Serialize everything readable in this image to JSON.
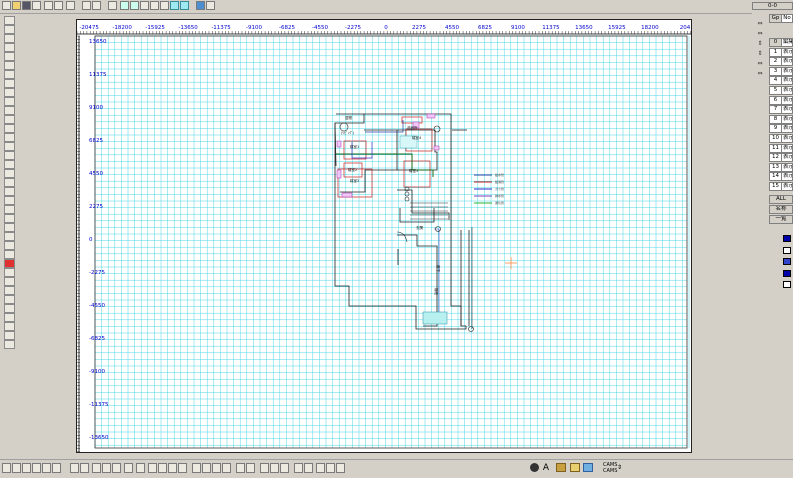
{
  "canvas": {
    "x_ruler_labels": [
      "-20475",
      "-18200",
      "-15925",
      "-13650",
      "-11375",
      "-9100",
      "-6825",
      "-4550",
      "-2275",
      "0",
      "2275",
      "4550",
      "6825",
      "9100",
      "11375",
      "13650",
      "15925",
      "18200",
      "204"
    ],
    "y_ruler_labels": [
      "13650",
      "11375",
      "9100",
      "6825",
      "4550",
      "2275",
      "0",
      "-2275",
      "-4550",
      "-6825",
      "-9100",
      "-11375",
      "-13650"
    ],
    "ruler_color": "#0000cc",
    "grid_color": "#4fd6e6",
    "plan_labels": [
      "居間",
      "(ﾘﾋﾞﾝｸﾞ)",
      "寝室1",
      "寝室2",
      "寝室3",
      "寝室4",
      "寝室5",
      "洗面所",
      "廊下",
      "玄関",
      "階段"
    ],
    "legend_items": [
      {
        "text": "給水管",
        "color": "#2040a0"
      },
      {
        "text": "給湯管",
        "color": "#cc2020"
      },
      {
        "text": "ガス管",
        "color": "#3030cc"
      },
      {
        "text": "排水管",
        "color": "#8040c0"
      },
      {
        "text": "通気管",
        "color": "#30b030"
      }
    ]
  },
  "right_panel": {
    "coord_display": "0-0",
    "header_gp": "Gp",
    "header_no": "No",
    "layer_rows": [
      {
        "num": "0",
        "name": "編集"
      },
      {
        "num": "1",
        "name": "表示"
      },
      {
        "num": "2",
        "name": "表示"
      },
      {
        "num": "3",
        "name": "表示"
      },
      {
        "num": "4",
        "name": "表示"
      },
      {
        "num": "5",
        "name": "表示"
      },
      {
        "num": "6",
        "name": "表示"
      },
      {
        "num": "7",
        "name": "表示"
      },
      {
        "num": "8",
        "name": "表示"
      },
      {
        "num": "9",
        "name": "表示"
      },
      {
        "num": "10",
        "name": "表示"
      },
      {
        "num": "11",
        "name": "表示"
      },
      {
        "num": "12",
        "name": "表示"
      },
      {
        "num": "13",
        "name": "表示"
      },
      {
        "num": "14",
        "name": "表示"
      },
      {
        "num": "15",
        "name": "表示"
      }
    ],
    "all_label": "ALL",
    "name_label": "名称",
    "list_label": "一覧",
    "swatch_colors": [
      "#0000aa",
      "#ffffff",
      "#3344cc",
      "#0000aa",
      "#ffffff"
    ]
  },
  "bottom_toolbar": {
    "text_tool_glyph": "A",
    "status_line1": "CAMS",
    "status_line2": "CAMS"
  }
}
